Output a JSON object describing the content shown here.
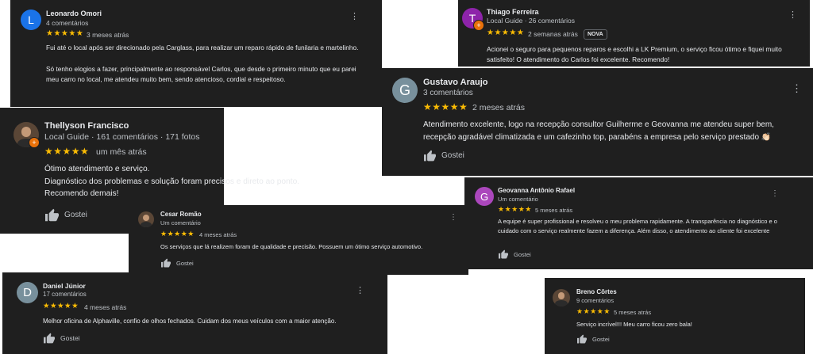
{
  "reviews": [
    {
      "name": "Leonardo Omori",
      "subtitle": "4 comentários",
      "avatar_letter": "L",
      "avatar_color": "#1a73e8",
      "stars": "★★★★★",
      "date": "3 meses atrás",
      "text": [
        "Fui até o local após ser direcionado pela Carglass, para realizar um reparo rápido de funilaria e martelinho.",
        "Só tenho elogios a fazer, principalmente ao responsável Carlos, que desde o primeiro minuto que eu parei meu carro no local, me atendeu muito bem, sendo atencioso, cordial e respeitoso."
      ]
    },
    {
      "name": "Thiago Ferreira",
      "subtitle": "Local Guide · 26 comentários",
      "avatar_letter": "T",
      "avatar_color": "#8e24aa",
      "stars": "★★★★★",
      "date": "2 semanas atrás",
      "badge": "NOVA",
      "text": "Acionei o seguro para pequenos reparos e escolhi a LK Premium, o serviço ficou ótimo e fiquei muito satisfeito! O atendimento do Carlos foi excelente. Recomendo!"
    },
    {
      "name": "Gustavo Araujo",
      "subtitle": "3 comentários",
      "avatar_letter": "G",
      "avatar_color": "#78909c",
      "stars": "★★★★★",
      "date": "2 meses atrás",
      "text": "Atendimento excelente, logo na recepção consultor Guilherme e Geovanna me atendeu super bem, recepção agradável climatizada e um cafezinho top, parabéns a empresa pelo serviço prestado 👏🏻",
      "like": "Gostei"
    },
    {
      "name": "Thellyson Francisco",
      "subtitle": "Local Guide · 161 comentários · 171 fotos",
      "stars": "★★★★★",
      "date": "um mês atrás",
      "text": [
        "Ótimo atendimento e serviço.",
        "Diagnóstico dos problemas e solução foram precisos e direto ao ponto.",
        "Recomendo demais!"
      ],
      "like": "Gostei"
    },
    {
      "name": "Cesar Romão",
      "subtitle": "Um comentário",
      "stars": "★★★★★",
      "date": "4 meses atrás",
      "text": "Os serviços que lá realizem foram de qualidade e precisão. Possuem um ótimo serviço automotivo.",
      "like": "Gostei"
    },
    {
      "name": "Geovanna Antônio Rafael",
      "subtitle": "Um comentário",
      "avatar_letter": "G",
      "avatar_color": "#ab47bc",
      "stars": "★★★★★",
      "date": "5 meses atrás",
      "text": "A equipe é super profissional e resolveu o meu problema rapidamente. A transparência no diagnóstico e o cuidado com o serviço realmente fazem a diferença. Além disso, o atendimento ao cliente foi excelente",
      "like": "Gostei"
    },
    {
      "name": "Daniel Júnior",
      "subtitle": "17 comentários",
      "avatar_letter": "D",
      "avatar_color": "#78909c",
      "stars": "★★★★★",
      "date": "4 meses atrás",
      "text": "Melhor oficina de Alphaville, confio de olhos fechados. Cuidam dos meus veículos com a maior atenção.",
      "like": "Gostei"
    },
    {
      "name": "Breno Côrtes",
      "subtitle": "9 comentários",
      "stars": "★★★★★",
      "date": "5 meses atrás",
      "text": "Serviço incrível!!! Meu carro ficou zero bala!",
      "like": "Gostei"
    }
  ]
}
